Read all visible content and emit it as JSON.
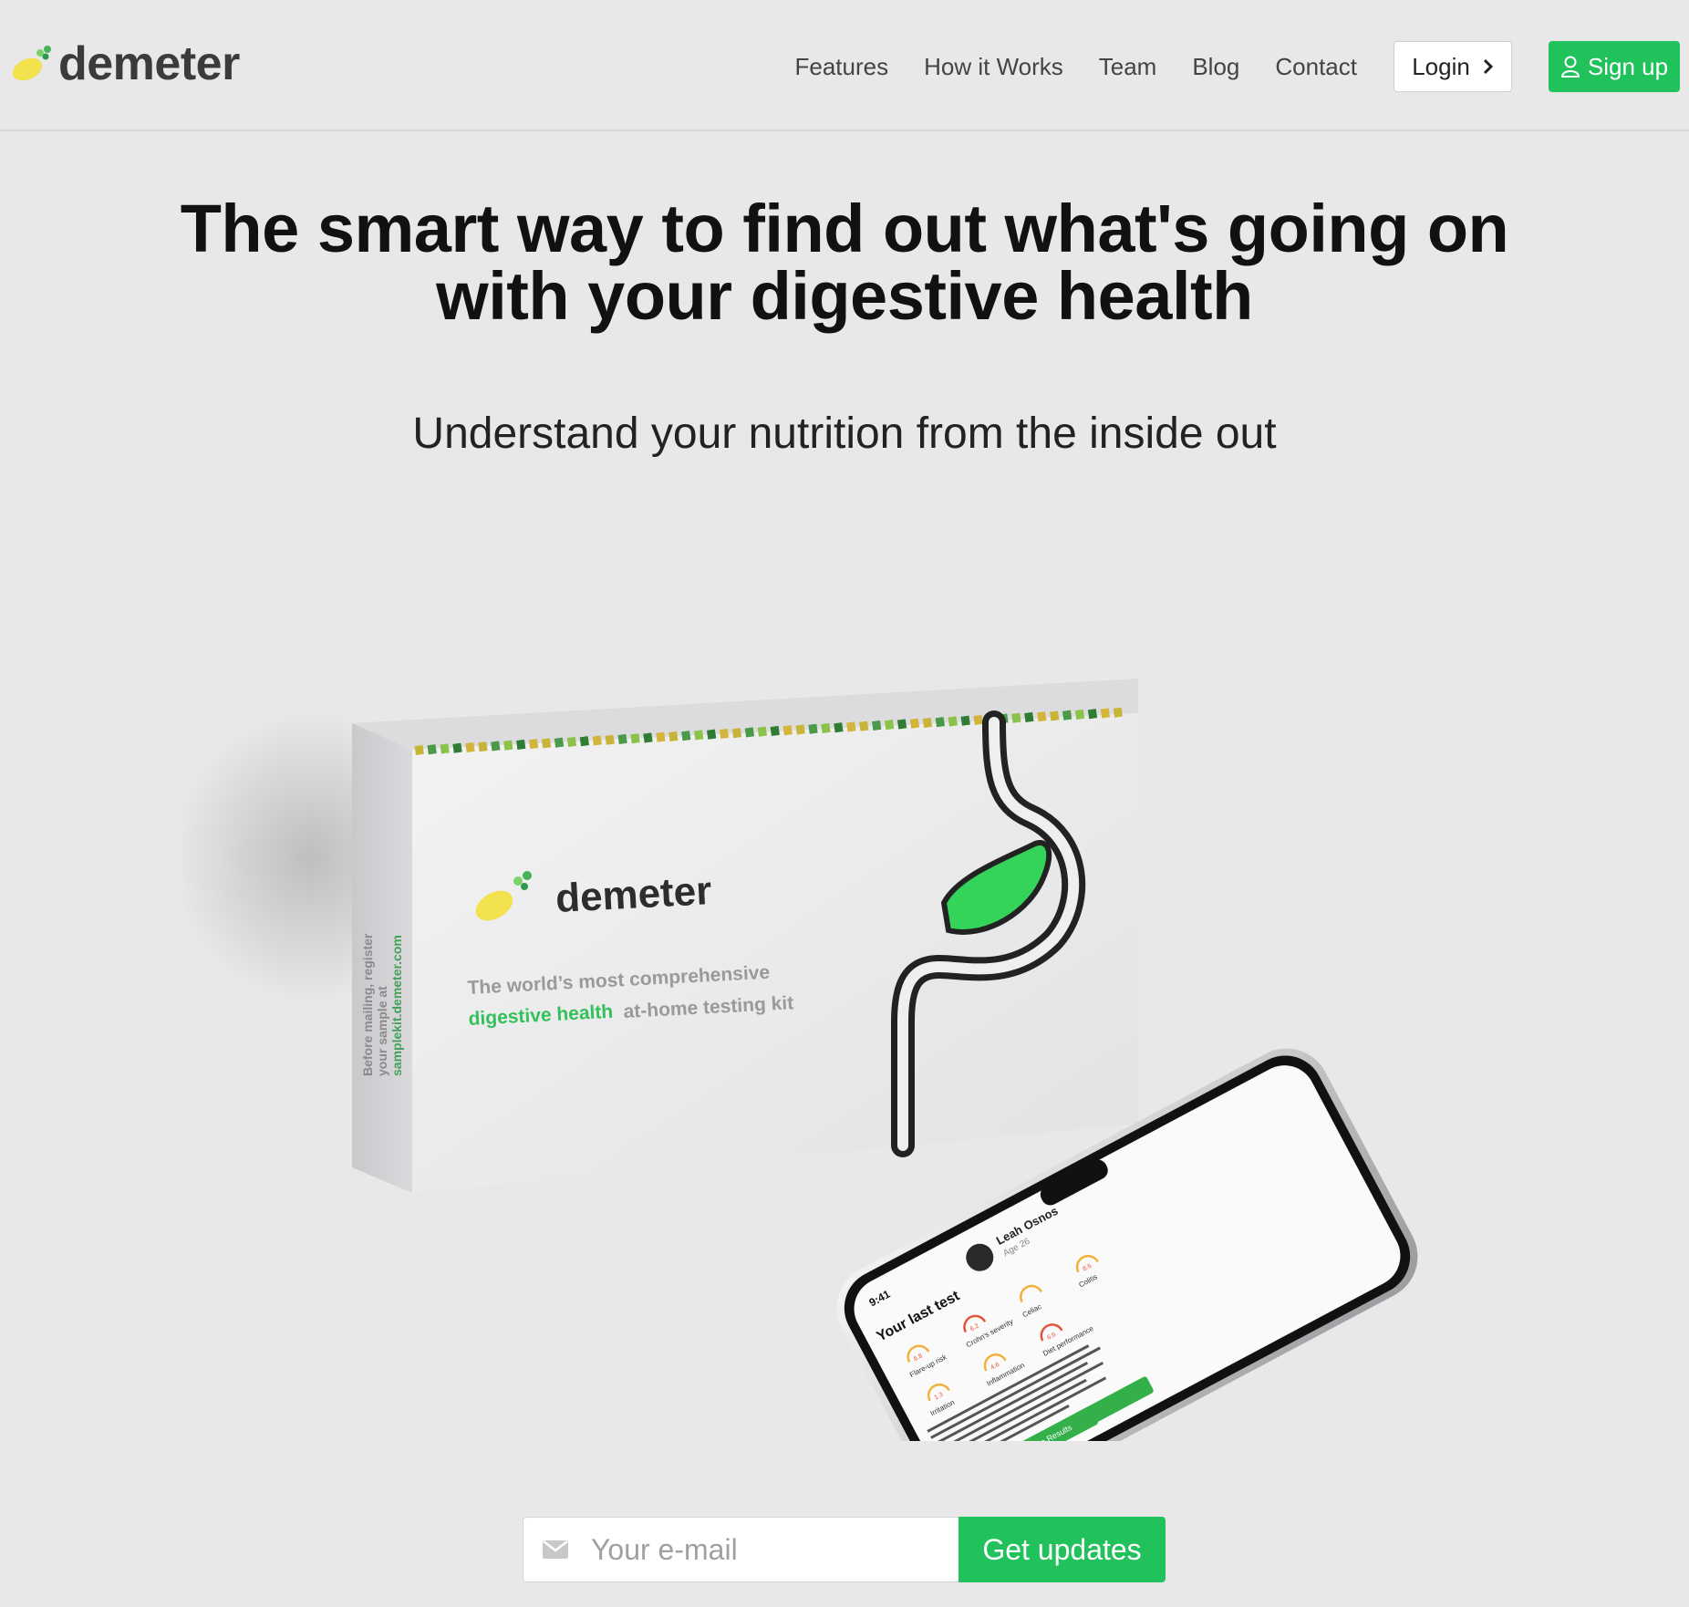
{
  "brand": {
    "name": "demeter",
    "accent": "#21c15b",
    "logo_yellow": "#f2e24d"
  },
  "nav": {
    "links": [
      "Features",
      "How it Works",
      "Team",
      "Blog",
      "Contact"
    ],
    "login_label": "Login",
    "login_icon": "chevron-right-icon",
    "signup_label": "Sign up",
    "signup_icon": "user-icon"
  },
  "hero": {
    "title_line1": "The smart way to find out what's going on",
    "title_line2": "with your digestive health",
    "subtitle": "Understand your nutrition from the inside out"
  },
  "product_box": {
    "brand": "demeter",
    "tagline_line1": "The world’s most comprehensive",
    "tagline_highlight": "digestive health",
    "tagline_rest": "at-home testing kit",
    "side_line1": "Before mailing, register",
    "side_line2": "your sample at",
    "side_url": "samplekit.demeter.com"
  },
  "phone": {
    "time": "9:41",
    "user_name": "Leah Osnos",
    "user_age": "Age 26",
    "heading": "Your last test",
    "metrics": [
      {
        "label": "Flare-up risk",
        "value": "6.8"
      },
      {
        "label": "Crohn's severity",
        "value": "6.2"
      },
      {
        "label": "Celiac",
        "value": ""
      },
      {
        "label": "Colitis",
        "value": "8.6"
      },
      {
        "label": "Irritation",
        "value": "1.3"
      },
      {
        "label": "Inflammation",
        "value": "4.6"
      },
      {
        "label": "Diet performance",
        "value": "6.6"
      }
    ],
    "share_label": "Share Results"
  },
  "signup_form": {
    "email_placeholder": "Your e-mail",
    "email_icon": "envelope-icon",
    "submit_label": "Get updates"
  }
}
